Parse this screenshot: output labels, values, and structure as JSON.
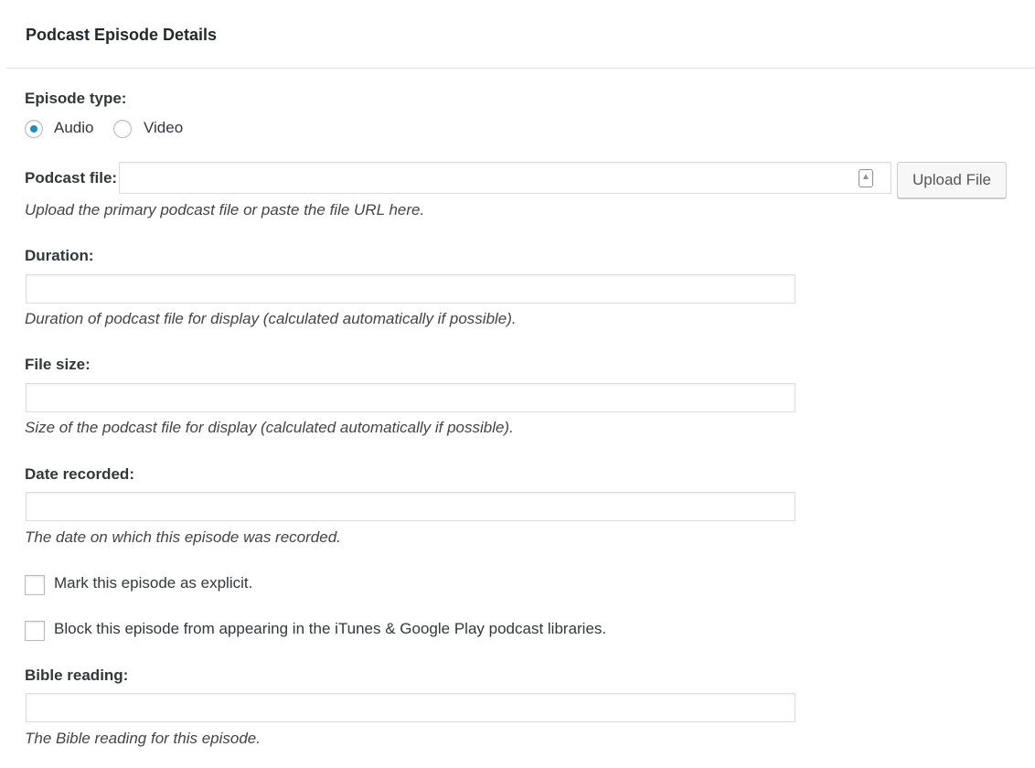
{
  "panel": {
    "title": "Podcast Episode Details"
  },
  "episode_type": {
    "label": "Episode type:",
    "options": [
      {
        "label": "Audio",
        "selected": true
      },
      {
        "label": "Video",
        "selected": false
      }
    ]
  },
  "podcast_file": {
    "label": "Podcast file:",
    "value": "",
    "icon": "file-icon",
    "upload_button_label": "Upload File",
    "description": "Upload the primary podcast file or paste the file URL here."
  },
  "duration": {
    "label": "Duration:",
    "value": "",
    "description": "Duration of podcast file for display (calculated automatically if possible)."
  },
  "file_size": {
    "label": "File size:",
    "value": "",
    "description": "Size of the podcast file for display (calculated automatically if possible)."
  },
  "date_recorded": {
    "label": "Date recorded:",
    "value": "",
    "description": "The date on which this episode was recorded."
  },
  "explicit": {
    "label": "Mark this episode as explicit.",
    "checked": false
  },
  "block": {
    "label": "Block this episode from appearing in the iTunes & Google Play podcast libraries.",
    "checked": false
  },
  "bible_reading": {
    "label": "Bible reading:",
    "value": "",
    "description": "The Bible reading for this episode."
  },
  "colors": {
    "radio_selected": "#1e8cbe",
    "border": "#dddddd",
    "text": "#32373c"
  }
}
